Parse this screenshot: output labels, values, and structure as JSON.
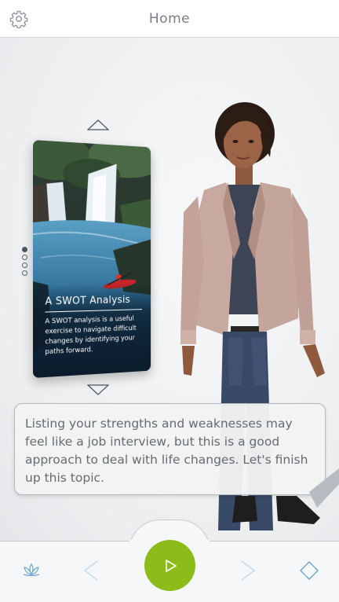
{
  "header": {
    "title": "Home",
    "settings_icon": "gear-icon"
  },
  "carousel": {
    "page_count": 4,
    "active_page": 1,
    "up_icon": "triangle-up-icon",
    "down_icon": "triangle-down-icon",
    "card": {
      "title": "A SWOT Analysis",
      "description": "A SWOT analysis is a useful exercise to navigate difficult changes by identifying your paths forward.",
      "image": "waterfall-kayak-image"
    }
  },
  "speech": {
    "text": "Listing your strengths and weaknesses may feel like a job interview, but this is a good approach to deal with life changes. Let's finish up this topic."
  },
  "footer": {
    "left_icon": "lotus-icon",
    "prev_icon": "chevron-left-icon",
    "play_icon": "play-icon",
    "next_icon": "chevron-right-icon",
    "right_icon": "diamond-arrows-icon"
  },
  "colors": {
    "accent_green": "#8cbc1a",
    "icon_blue": "#6fa6cf",
    "text_gray": "#666b72"
  }
}
